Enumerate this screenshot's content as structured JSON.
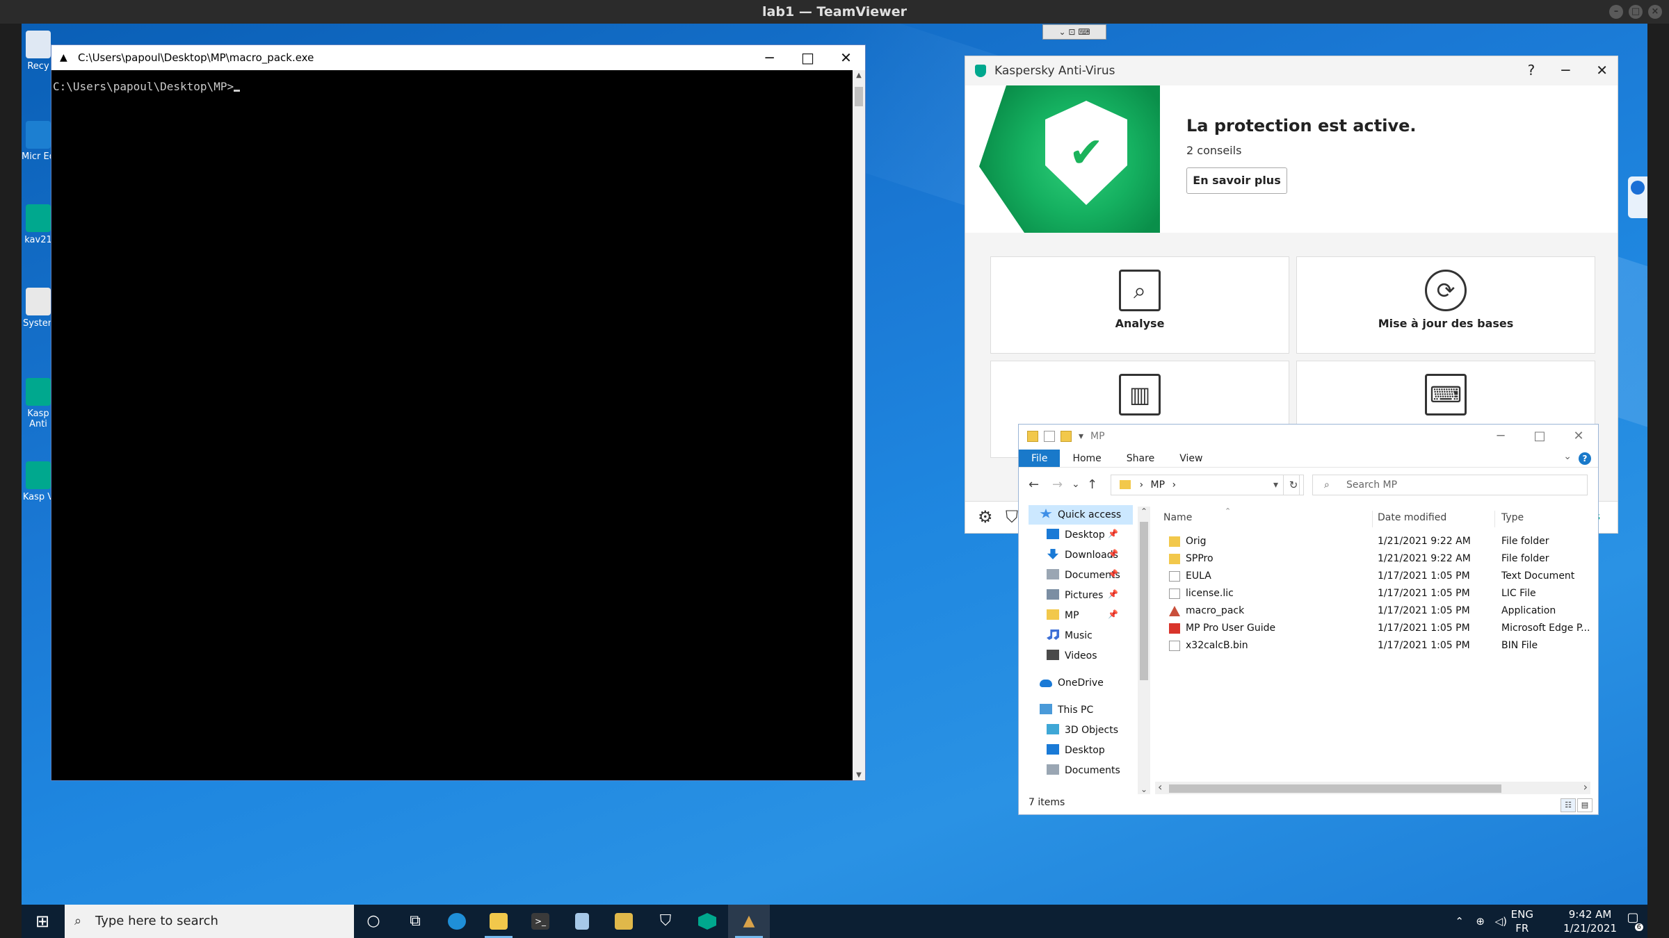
{
  "teamviewer": {
    "title": "lab1 — TeamViewer",
    "minimize_glyph": "–",
    "maximize_glyph": "□",
    "close_glyph": "×",
    "toolbar_glyph": "⌄ ⊡ ⌨"
  },
  "desktop": {
    "icons": [
      {
        "label": "Recy",
        "color": "#dfe8f3"
      },
      {
        "label": "Micr Ed",
        "color": "#1c7fd1"
      },
      {
        "label": "kav21",
        "color": "#00a88e"
      },
      {
        "label": "Systen",
        "color": "#e8e8e8"
      },
      {
        "label": "Kasp Anti",
        "color": "#00a88e"
      },
      {
        "label": "Kasp V",
        "color": "#00a88e"
      }
    ]
  },
  "cmd": {
    "title": "C:\\Users\\papoul\\Desktop\\MP\\macro_pack.exe",
    "prompt": "C:\\Users\\papoul\\Desktop\\MP>",
    "minimize_glyph": "─",
    "maximize_glyph": "□",
    "close_glyph": "✕",
    "scroll_up_glyph": "▲",
    "scroll_down_glyph": "▼"
  },
  "kaspersky": {
    "title": "Kaspersky Anti-Virus",
    "help_glyph": "?",
    "minimize_glyph": "─",
    "close_glyph": "✕",
    "check_glyph": "✔",
    "headline": "La protection est active.",
    "advice": "2 conseils",
    "more_button": "En savoir plus",
    "tiles": [
      {
        "label": "Analyse",
        "icon": "⌕"
      },
      {
        "label": "Mise à jour des bases",
        "icon": "⟳"
      },
      {
        "label": "",
        "icon": "▥"
      },
      {
        "label": "",
        "icon": "⌨"
      }
    ],
    "settings_glyph": "⚙",
    "support_glyph": "⛉",
    "footer_right": "rs"
  },
  "explorer": {
    "title": "MP",
    "minimize_glyph": "─",
    "maximize_glyph": "□",
    "close_glyph": "✕",
    "dropdown_glyph": "▾",
    "tabs": [
      "File",
      "Home",
      "Share",
      "View"
    ],
    "help_glyph": "?",
    "collapse_glyph": "⌄",
    "back_glyph": "←",
    "forward_glyph": "→",
    "recent_glyph": "⌄",
    "up_glyph": "↑",
    "refresh_glyph": "↻",
    "path": "MP",
    "path_sep": "›",
    "search_placeholder": "Search MP",
    "search_glyph": "⌕",
    "nav": [
      {
        "label": "Quick access",
        "pinned": false,
        "color": "#3d8ee6"
      },
      {
        "label": "Desktop",
        "pinned": true,
        "color": "#1a7ad6"
      },
      {
        "label": "Downloads",
        "pinned": true,
        "color": "#1a7ad6"
      },
      {
        "label": "Documents",
        "pinned": true,
        "color": "#9aa6b3"
      },
      {
        "label": "Pictures",
        "pinned": true,
        "color": "#7b8ea3"
      },
      {
        "label": "MP",
        "pinned": true,
        "color": "#f2c84b"
      },
      {
        "label": "Music",
        "pinned": false,
        "color": "#3d6fd6"
      },
      {
        "label": "Videos",
        "pinned": false,
        "color": "#4a4a4a"
      },
      {
        "label": "OneDrive",
        "pinned": false,
        "color": "#1a7ad6"
      },
      {
        "label": "This PC",
        "pinned": false,
        "color": "#4a9ad9"
      },
      {
        "label": "3D Objects",
        "pinned": false,
        "color": "#3fa7d6"
      },
      {
        "label": "Desktop",
        "pinned": false,
        "color": "#1a7ad6"
      },
      {
        "label": "Documents",
        "pinned": false,
        "color": "#9aa6b3"
      }
    ],
    "pin_glyph": "📌",
    "columns": {
      "name": "Name",
      "date": "Date modified",
      "type": "Type",
      "sort_glyph": "⌃"
    },
    "files": [
      {
        "name": "Orig",
        "date": "1/21/2021 9:22 AM",
        "type": "File folder",
        "icon_color": "#f2c84b"
      },
      {
        "name": "SPPro",
        "date": "1/21/2021 9:22 AM",
        "type": "File folder",
        "icon_color": "#f2c84b"
      },
      {
        "name": "EULA",
        "date": "1/17/2021 1:05 PM",
        "type": "Text Document",
        "icon_color": "#ffffff"
      },
      {
        "name": "license.lic",
        "date": "1/17/2021 1:05 PM",
        "type": "LIC File",
        "icon_color": "#ffffff"
      },
      {
        "name": "macro_pack",
        "date": "1/17/2021 1:05 PM",
        "type": "Application",
        "icon_color": "#c94f3b"
      },
      {
        "name": "MP Pro User Guide",
        "date": "1/17/2021 1:05 PM",
        "type": "Microsoft Edge P...",
        "icon_color": "#d9342b"
      },
      {
        "name": "x32calcB.bin",
        "date": "1/17/2021 1:05 PM",
        "type": "BIN File",
        "icon_color": "#ffffff"
      }
    ],
    "status": "7 items",
    "details_view_glyph": "☷",
    "tiles_view_glyph": "▤",
    "scroll_left_glyph": "‹",
    "scroll_right_glyph": "›",
    "scroll_up_glyph": "⌃",
    "scroll_down_glyph": "⌄"
  },
  "taskbar": {
    "start_glyph": "⊞",
    "search_placeholder": "Type here to search",
    "search_glyph": "⌕",
    "apps": [
      {
        "name": "cortana",
        "glyph": "○",
        "color": "transparent"
      },
      {
        "name": "task-view",
        "glyph": "⧉",
        "color": "transparent"
      },
      {
        "name": "edge",
        "glyph": "",
        "color": "#1f8fd8"
      },
      {
        "name": "file-explorer",
        "glyph": "",
        "color": "#f2c84b"
      },
      {
        "name": "terminal",
        "glyph": ">_",
        "color": "#3a3a3a"
      },
      {
        "name": "notepad",
        "glyph": "",
        "color": "#a6c8e8"
      },
      {
        "name": "paint",
        "glyph": "",
        "color": "#e0b84a"
      },
      {
        "name": "security",
        "glyph": "⛉",
        "color": "transparent"
      },
      {
        "name": "kaspersky",
        "glyph": "",
        "color": "#00a88e"
      },
      {
        "name": "macro-pack",
        "glyph": "▲",
        "color": "transparent"
      }
    ],
    "tray_up_glyph": "⌃",
    "network_glyph": "⊕",
    "volume_glyph": "◁)",
    "lang_top": "ENG",
    "lang_bottom": "FR",
    "time": "9:42 AM",
    "date": "1/21/2021",
    "notification_glyph": "▢",
    "notification_count": "6"
  }
}
